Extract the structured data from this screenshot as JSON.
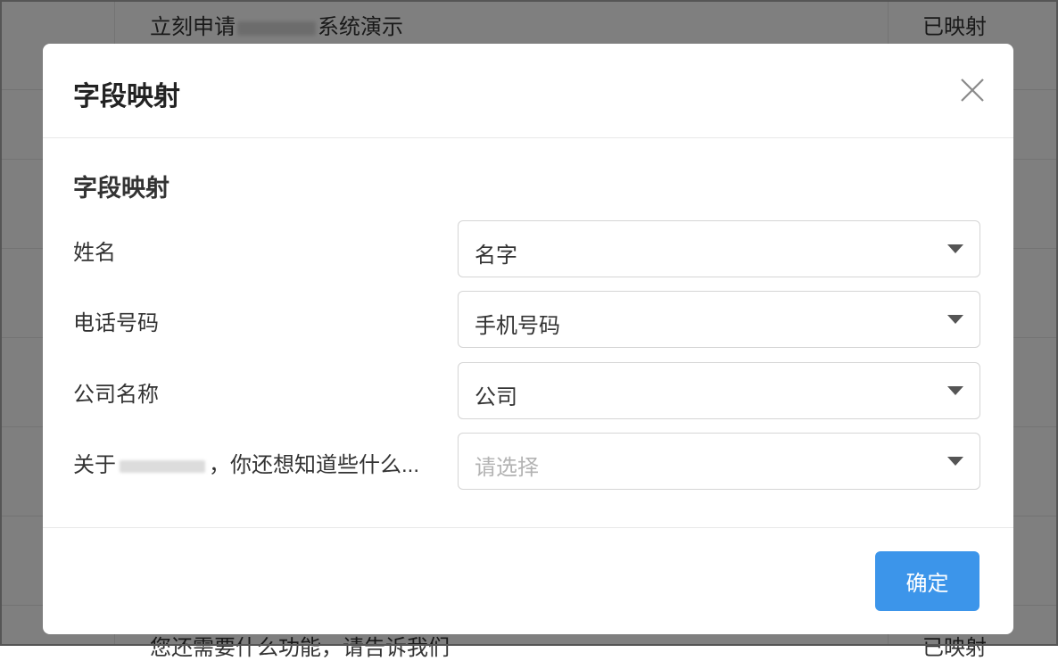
{
  "background": {
    "row_title_prefix": "立刻申请",
    "row_title_suffix": "系统演示",
    "row_status": "已映射",
    "bottom_row_text": "您还需要什么功能，请告诉我们",
    "bottom_row_status": "已映射"
  },
  "modal": {
    "title": "字段映射",
    "section_title": "字段映射",
    "fields": [
      {
        "label": "姓名",
        "value": "名字"
      },
      {
        "label": "电话号码",
        "value": "手机号码"
      },
      {
        "label": "公司名称",
        "value": "公司"
      },
      {
        "label_prefix": "关于",
        "label_suffix": "，你还想知道些什么...",
        "value": "",
        "placeholder": "请选择"
      }
    ],
    "confirm_label": "确定",
    "close_icon": "close-icon"
  }
}
